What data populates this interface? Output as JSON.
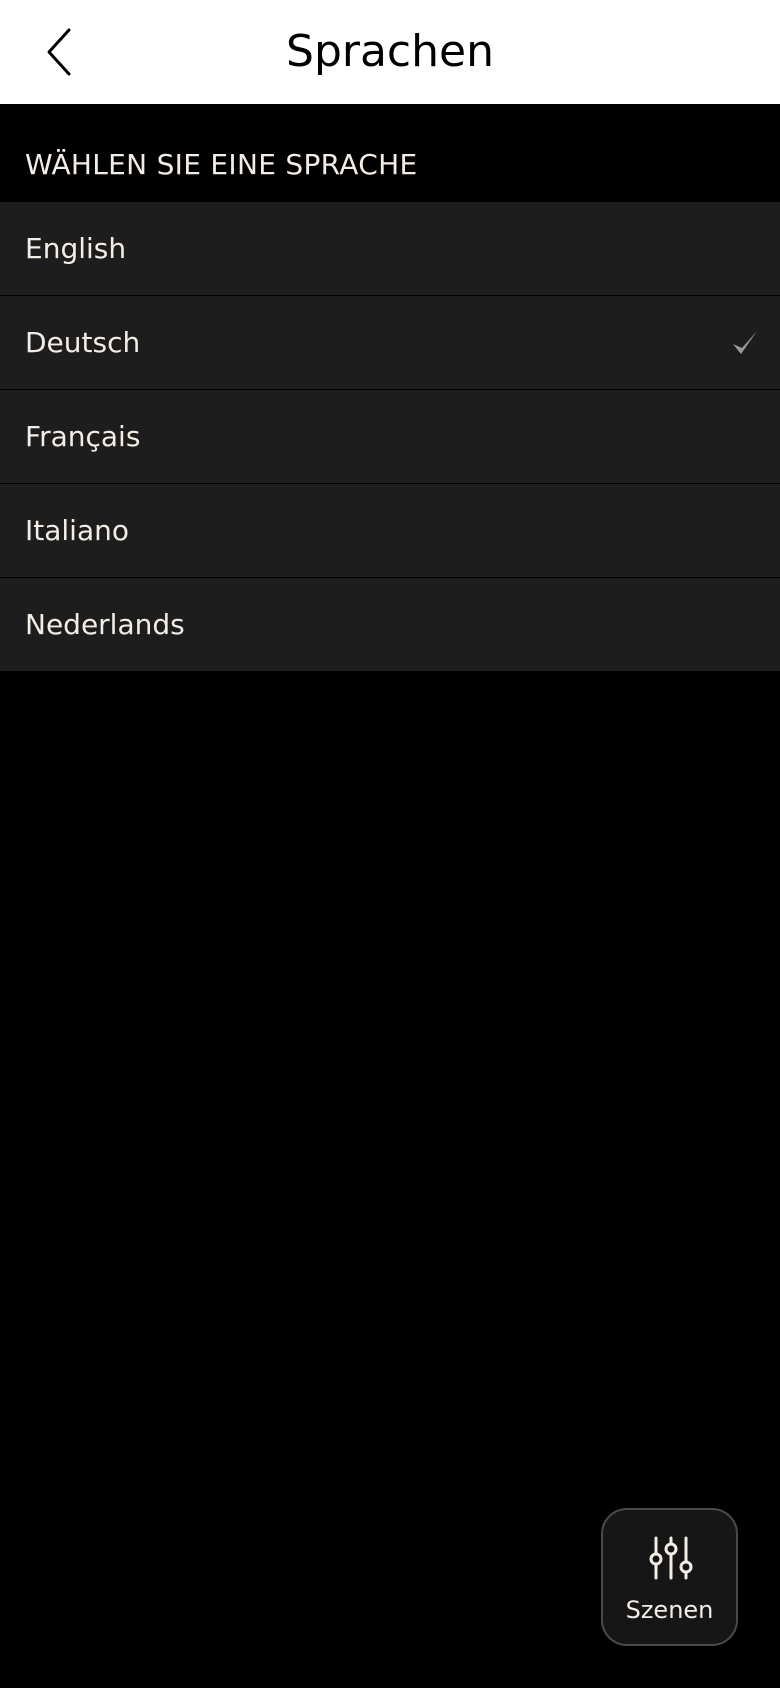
{
  "header": {
    "title": "Sprachen",
    "back_icon": "chevron-left-icon"
  },
  "section": {
    "heading": "WÄHLEN SIE EINE SPRACHE"
  },
  "languages": [
    {
      "label": "English",
      "selected": false
    },
    {
      "label": "Deutsch",
      "selected": true
    },
    {
      "label": "Français",
      "selected": false
    },
    {
      "label": "Italiano",
      "selected": false
    },
    {
      "label": "Nederlands",
      "selected": false
    }
  ],
  "fab": {
    "label": "Szenen",
    "icon": "sliders-icon"
  },
  "colors": {
    "background": "#000000",
    "header_bg": "#ffffff",
    "row_bg": "#1d1d1d",
    "text": "#f4ede6",
    "check": "#9a9a9a"
  }
}
